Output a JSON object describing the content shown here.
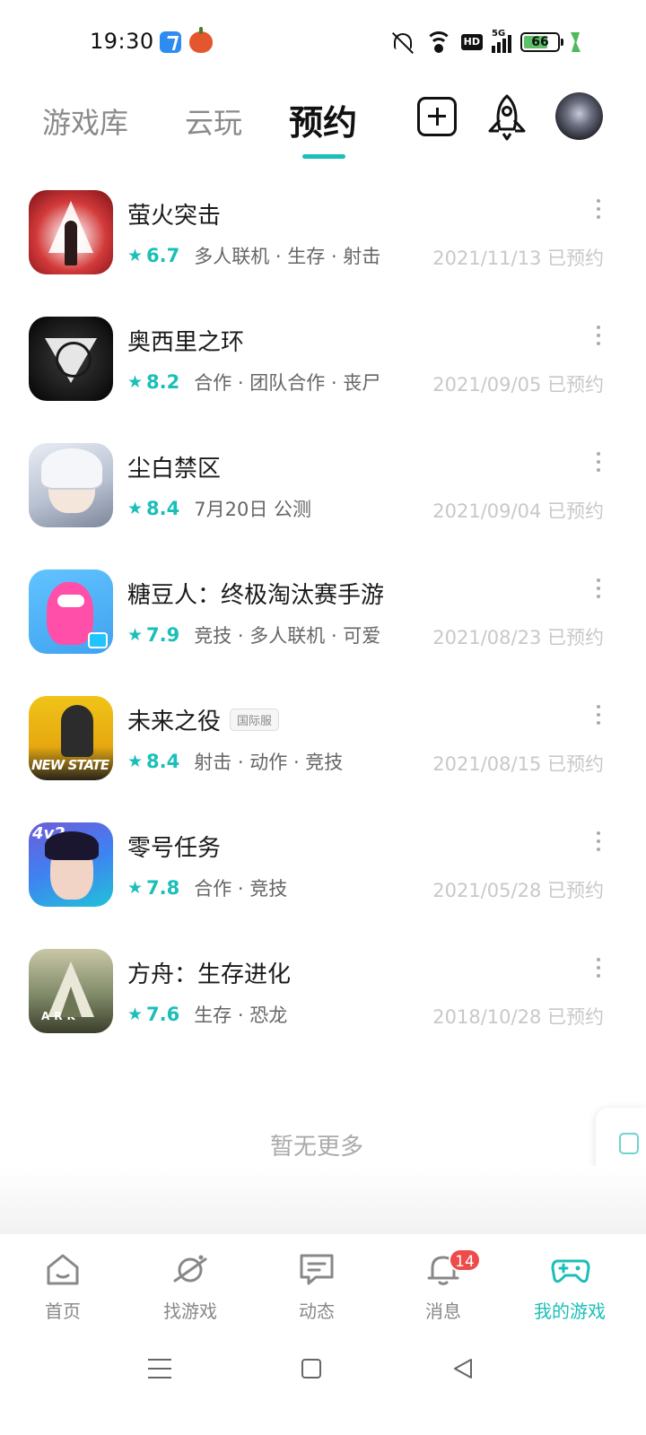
{
  "status_bar": {
    "time": "19:30",
    "network_label": "5G",
    "hd_label": "HD",
    "battery": "66"
  },
  "header": {
    "tabs": [
      {
        "label": "游戏库"
      },
      {
        "label": "云玩"
      },
      {
        "label": "预约"
      }
    ],
    "active_tab": "预约",
    "accent_color": "#1bbfb8"
  },
  "games": [
    {
      "name": "萤火突击",
      "rating": "6.7",
      "tags": "多人联机 · 生存 · 射击",
      "date": "2021/11/13 已预约"
    },
    {
      "name": "奥西里之环",
      "rating": "8.2",
      "tags": "合作 · 团队合作 · 丧尸",
      "date": "2021/09/05 已预约"
    },
    {
      "name": "尘白禁区",
      "rating": "8.4",
      "tags": "7月20日 公测",
      "date": "2021/09/04 已预约"
    },
    {
      "name": "糖豆人：终极淘汰赛手游",
      "rating": "7.9",
      "tags": "竞技 · 多人联机 · 可爱",
      "date": "2021/08/23 已预约"
    },
    {
      "name": "未来之役",
      "badge": "国际服",
      "rating": "8.4",
      "tags": "射击 · 动作 · 竞技",
      "date": "2021/08/15 已预约",
      "icon_text": "NEW STATE"
    },
    {
      "name": "零号任务",
      "rating": "7.8",
      "tags": "合作 · 竞技",
      "date": "2021/05/28 已预约",
      "icon_text": "4v2"
    },
    {
      "name": "方舟：生存进化",
      "rating": "7.6",
      "tags": "生存 · 恐龙",
      "date": "2018/10/28 已预约",
      "icon_text": "ARK"
    }
  ],
  "list_footer": "暂无更多",
  "bottom_nav": {
    "items": [
      {
        "label": "首页",
        "icon": "home-icon"
      },
      {
        "label": "找游戏",
        "icon": "planet-icon"
      },
      {
        "label": "动态",
        "icon": "chat-icon"
      },
      {
        "label": "消息",
        "icon": "bell-icon",
        "badge": "14"
      },
      {
        "label": "我的游戏",
        "icon": "gamepad-icon"
      }
    ],
    "active": "我的游戏"
  }
}
